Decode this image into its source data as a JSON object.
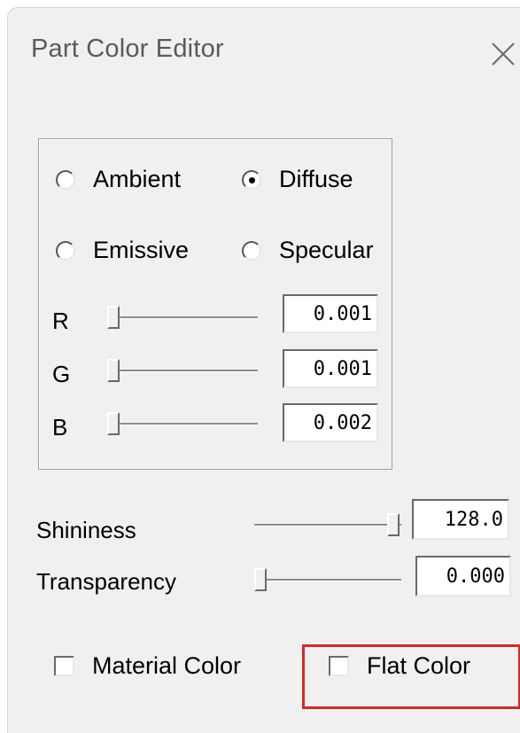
{
  "window": {
    "title": "Part Color Editor"
  },
  "icons": {
    "close": "close-icon"
  },
  "material": {
    "radios": [
      {
        "label": "Ambient",
        "checked": false
      },
      {
        "label": "Diffuse",
        "checked": true
      },
      {
        "label": "Emissive",
        "checked": false
      },
      {
        "label": "Specular",
        "checked": false
      }
    ],
    "channels": [
      {
        "label": "R",
        "value": "0.001",
        "slider_fraction": 0.001
      },
      {
        "label": "G",
        "value": "0.001",
        "slider_fraction": 0.001
      },
      {
        "label": "B",
        "value": "0.002",
        "slider_fraction": 0.002
      }
    ]
  },
  "shininess": {
    "label": "Shininess",
    "value": "128.0",
    "slider_fraction": 1.0
  },
  "transparency": {
    "label": "Transparency",
    "value": "0.000",
    "slider_fraction": 0.0
  },
  "checkboxes": {
    "material_color": {
      "label": "Material Color",
      "checked": false
    },
    "flat_color": {
      "label": "Flat Color",
      "checked": false
    }
  },
  "colors": {
    "highlight": "#d42a22",
    "window_bg": "#f0f0f0"
  }
}
